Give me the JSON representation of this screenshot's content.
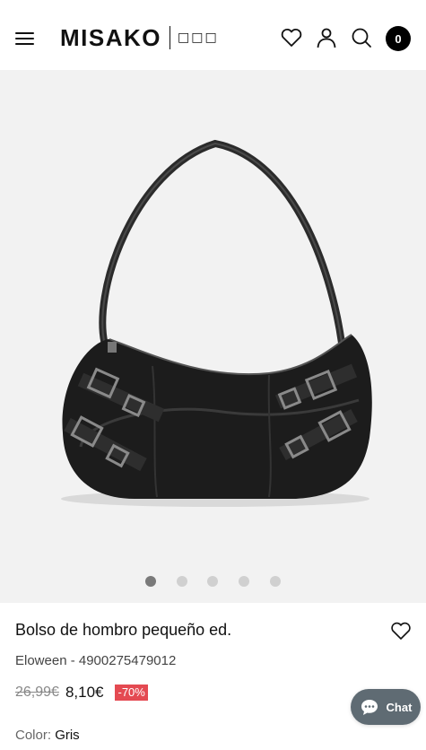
{
  "header": {
    "logo_text": "MISAKO",
    "logo_suffix": "□□□",
    "cart_count": "0",
    "icons": [
      "menu-icon",
      "heart-icon",
      "user-icon",
      "search-icon",
      "cart-icon"
    ]
  },
  "gallery": {
    "image_description_icon": "shoulder-bag-icon",
    "dots": 5,
    "active_dot": 1
  },
  "product": {
    "title": "Bolso de hombro pequeño ed.",
    "subtitle": "Eloween - 4900275479012",
    "old_price": "26,99€",
    "new_price": "8,10€",
    "discount": "-70%",
    "color_label": "Color:",
    "color_value": "Gris"
  },
  "chat": {
    "label": "Chat"
  },
  "colors": {
    "discount_bg": "#e44a52",
    "chat_bg": "#5f6b73",
    "gallery_bg": "#f2f2f2",
    "cart_badge_bg": "#000000"
  }
}
